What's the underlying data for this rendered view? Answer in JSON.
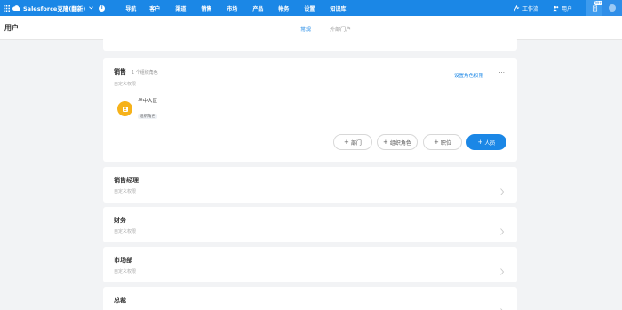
{
  "topnav": {
    "app_title": "Salesforce克隆(翻新)",
    "info_label": "i",
    "items": [
      "导航",
      "客户",
      "渠道",
      "销售",
      "市场",
      "产品",
      "帐务",
      "设置",
      "知识库"
    ],
    "right": {
      "workbench_label": "工作流",
      "users_label": "用户",
      "badge_count": "99+"
    },
    "accent": "#1b87e6"
  },
  "subheader": {
    "page_title": "用户",
    "tabs": [
      {
        "label": "常规",
        "active": true
      },
      {
        "label": "外部门户",
        "active": false
      }
    ]
  },
  "cards": [
    {
      "title": "销售",
      "count": "1 个组织角色",
      "subtitle": "自定义权限",
      "link": "设置角色权限",
      "more": "···",
      "member": {
        "name": "华中大区",
        "tag": "组织角色"
      },
      "buttons": [
        {
          "label": "部门",
          "icon": "plus-icon"
        },
        {
          "label": "组织角色",
          "icon": "plus-icon"
        },
        {
          "label": "职位",
          "icon": "plus-icon"
        },
        {
          "label": "人员",
          "icon": "plus-icon",
          "primary": true
        }
      ]
    },
    {
      "title": "销售经理",
      "subtitle": "自定义权限"
    },
    {
      "title": "财务",
      "subtitle": "自定义权限"
    },
    {
      "title": "市场部",
      "subtitle": "自定义权限"
    },
    {
      "title": "总裁",
      "subtitle": ""
    }
  ]
}
